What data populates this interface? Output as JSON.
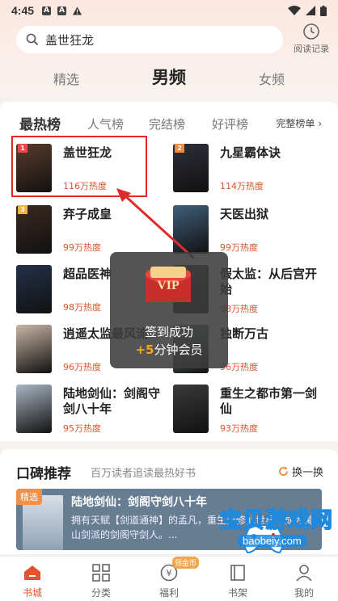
{
  "status_bar": {
    "time": "4:45",
    "icons": [
      "a-icon",
      "a-icon",
      "warning-icon",
      "wifi-icon",
      "signal-icon",
      "battery-icon"
    ]
  },
  "search": {
    "query": "盖世狂龙"
  },
  "history_label": "阅读记录",
  "top_tabs": [
    {
      "label": "精选",
      "active": false
    },
    {
      "label": "男频",
      "active": true
    },
    {
      "label": "女频",
      "active": false
    }
  ],
  "ranking": {
    "tabs": [
      {
        "label": "最热榜",
        "active": true
      },
      {
        "label": "人气榜",
        "active": false
      },
      {
        "label": "完结榜",
        "active": false
      },
      {
        "label": "好评榜",
        "active": false
      }
    ],
    "more_label": "完整榜单",
    "books": [
      {
        "rank": "1",
        "title": "盖世狂龙",
        "heat": "116万热度",
        "cover_color": "#5a3b2c"
      },
      {
        "rank": "2",
        "title": "九星霸体诀",
        "heat": "114万热度",
        "cover_color": "#2e2f3a"
      },
      {
        "rank": "3",
        "title": "弃子成皇",
        "heat": "99万热度",
        "cover_color": "#3a2a22"
      },
      {
        "rank": "",
        "title": "天医出狱",
        "heat": "99万热度",
        "cover_color": "#3f5f7a"
      },
      {
        "rank": "",
        "title": "超品医神",
        "heat": "98万热度",
        "cover_color": "#24304a"
      },
      {
        "rank": "",
        "title": "假太监：从后宫开始",
        "heat": "98万热度",
        "cover_color": "#4a3a3a"
      },
      {
        "rank": "",
        "title": "逍遥太监最风流",
        "heat": "96万热度",
        "cover_color": "#c8b6a6"
      },
      {
        "rank": "",
        "title": "独断万古",
        "heat": "96万热度",
        "cover_color": "#7c8a92"
      },
      {
        "rank": "",
        "title": "陆地剑仙：剑阁守剑八十年",
        "heat": "95万热度",
        "cover_color": "#aab6c2"
      },
      {
        "rank": "",
        "title": "重生之都市第一剑仙",
        "heat": "93万热度",
        "cover_color": "#3a3a3a"
      }
    ]
  },
  "toast": {
    "vip": "VIP",
    "line1": "签到成功",
    "plus": "+5",
    "line2_rest": "分钟会员"
  },
  "recommend": {
    "title": "口碑推荐",
    "subtitle": "百万读者追读最热好书",
    "refresh": "换一换",
    "tag": "精选",
    "book_title": "陆地剑仙：剑阁守剑八十年",
    "desc": "拥有天赋【剑道通神】的孟凡，重生到修仙世界，成为蜀山剑派的剑阁守剑人。..."
  },
  "bottom_nav": [
    {
      "label": "书城",
      "active": true,
      "icon": "home-icon"
    },
    {
      "label": "分类",
      "active": false,
      "icon": "grid-icon"
    },
    {
      "label": "福利",
      "active": false,
      "icon": "coin-icon",
      "badge": "领金币"
    },
    {
      "label": "书架",
      "active": false,
      "icon": "book-icon"
    },
    {
      "label": "我的",
      "active": false,
      "icon": "user-icon"
    }
  ],
  "watermark": {
    "text": "宝贝游戏网",
    "url": "baobeiy.com"
  }
}
